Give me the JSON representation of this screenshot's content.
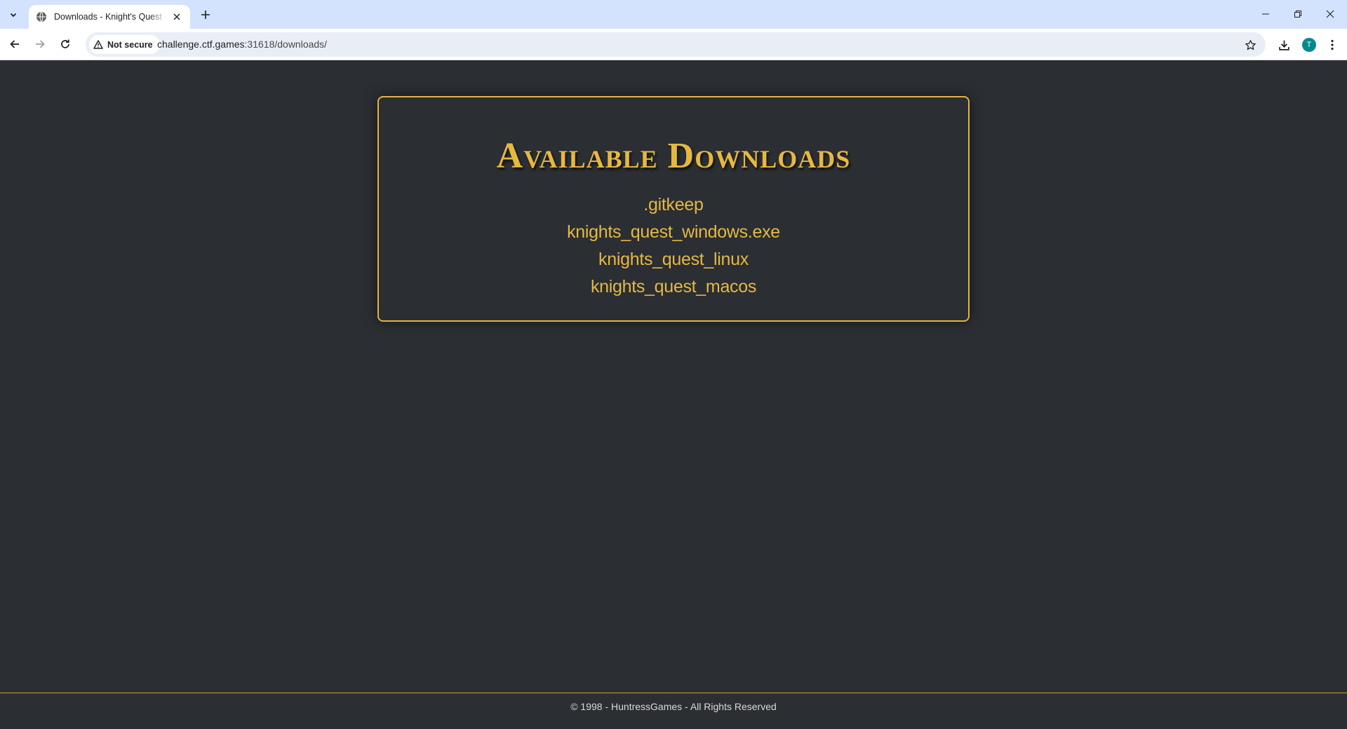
{
  "browser": {
    "tab": {
      "title": "Downloads - Knight's Quest CTF"
    },
    "address_bar": {
      "security_label": "Not secure",
      "url_host": "challenge.ctf.games",
      "url_rest": ":31618/downloads/"
    },
    "profile_initial": "T",
    "icons": [
      "chevron-down-icon",
      "globe-icon",
      "close-icon",
      "plus-icon",
      "minimize-icon",
      "restore-icon",
      "back-arrow-icon",
      "forward-arrow-icon",
      "reload-icon",
      "warning-icon",
      "star-icon",
      "download-icon",
      "kebab-menu-icon"
    ]
  },
  "page": {
    "heading": "Available Downloads",
    "files": [
      {
        "name": ".gitkeep"
      },
      {
        "name": "knights_quest_windows.exe"
      },
      {
        "name": "knights_quest_linux"
      },
      {
        "name": "knights_quest_macos"
      }
    ],
    "footer": "© 1998 - HuntressGames - All Rights Reserved"
  },
  "colors": {
    "page_background": "#2b2e33",
    "accent_gold": "#e6b840",
    "tabbar_background": "#d3e3fd"
  }
}
